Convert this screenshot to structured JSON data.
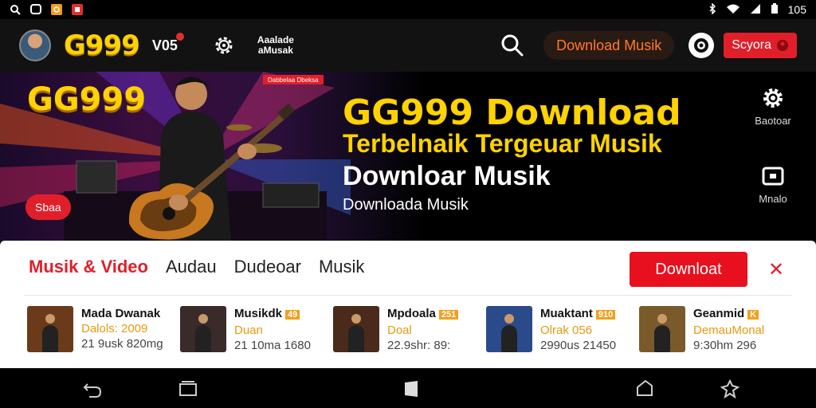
{
  "status_bar": {
    "time": "105"
  },
  "app_bar": {
    "brand": "G999",
    "nav_vos": "V05",
    "nav_music_line1": "Aaalade",
    "nav_music_line2": "aMusak",
    "download_button": "Download Musik",
    "signup_button": "Scyora"
  },
  "hero": {
    "brand": "GG999",
    "badge": "Dabbelaa Dbeksa",
    "pill": "Sbaa",
    "title": "GG999 Download",
    "subtitle1": "Terbelnaik Tergeuar Musik",
    "subtitle2": "Downloar Musik",
    "subtitle3": "Downloada Musik",
    "side_settings_label": "Baotoar",
    "side_media_label": "Mnalo"
  },
  "content": {
    "tabs": [
      {
        "label": "Musik & Video",
        "active": true
      },
      {
        "label": "Audau",
        "active": false
      },
      {
        "label": "Dudeoar",
        "active": false
      },
      {
        "label": "Musik",
        "active": false
      }
    ],
    "download_button": "Downloat",
    "close_label": "✕",
    "items": [
      {
        "title": "Mada Dwanak",
        "badge": "",
        "artist": "Dalols: 2009",
        "details": "21 9usk 820mg",
        "thumb_color": "#6a3a1a"
      },
      {
        "title": "Musikdk",
        "badge": "49",
        "artist": "Duan",
        "details": "21 10ma 1680",
        "thumb_color": "#3a2a2a"
      },
      {
        "title": "Mpdoala",
        "badge": "251",
        "artist": "Doal",
        "details": "22.9shr: 89:",
        "thumb_color": "#4a2a1a"
      },
      {
        "title": "Muaktant",
        "badge": "910",
        "artist": "Olrak 056",
        "details": "2990us 21450",
        "thumb_color": "#2a4a8a"
      },
      {
        "title": "Geanmid",
        "badge": "K",
        "artist": "DemauMonal",
        "details": "9:30hm      296",
        "thumb_color": "#7a5a2a"
      }
    ]
  },
  "colors": {
    "accent_red": "#e01f2a",
    "brand_yellow": "#ffd200",
    "download_orange": "#ff7a2a"
  }
}
